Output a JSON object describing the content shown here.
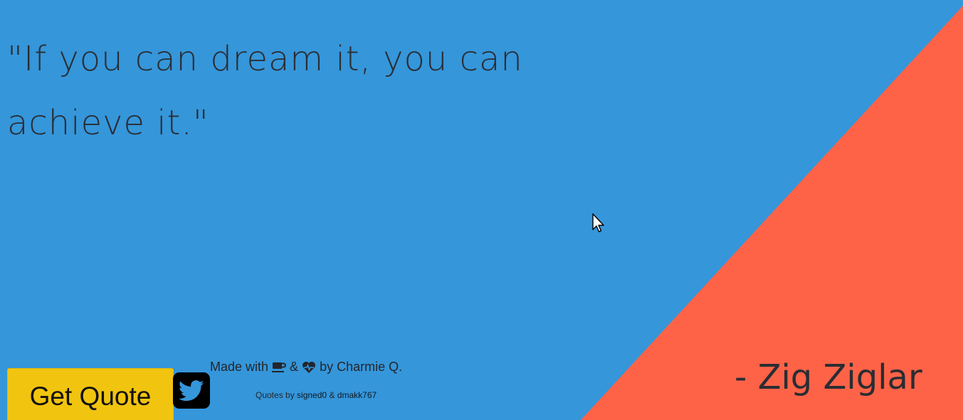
{
  "quote": {
    "text": "\"If you can dream it, you can achieve it.\"",
    "author": "- Zig Ziglar"
  },
  "actions": {
    "get_quote_label": "Get Quote",
    "tweet_icon": "twitter-icon"
  },
  "footer": {
    "made_with_prefix": "Made with",
    "coffee_icon": "coffee-icon",
    "ampersand": "&",
    "heartbeat_icon": "heartbeat-icon",
    "made_with_suffix": "by Charmie Q.",
    "quotes_by_prefix": "Quotes by",
    "author_one": "signed0",
    "author_two": "dmakk767"
  },
  "colors": {
    "background": "#3596da",
    "accent": "#ff6347",
    "button": "#f1c40f",
    "text": "#2a2d33"
  }
}
